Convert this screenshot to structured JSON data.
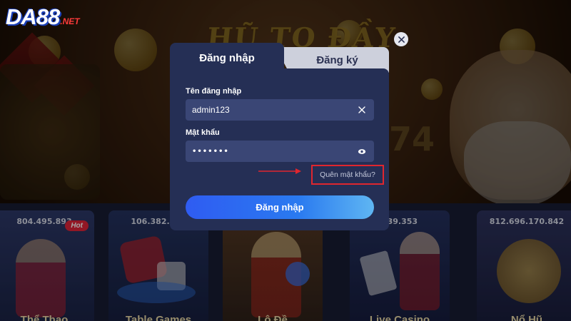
{
  "logo": {
    "main": "DA88",
    "sub": ".NET"
  },
  "background": {
    "jackpot_title": "HŨ TO ĐẦY",
    "side_number": "74"
  },
  "tabs": [
    {
      "label": "Đăng nhập",
      "active": true
    },
    {
      "label": "Đăng ký",
      "active": false
    }
  ],
  "form": {
    "username_label": "Tên đăng nhập",
    "username_value": "admin123",
    "password_label": "Mật khẩu",
    "password_value": "•••••••",
    "forgot_label": "Quên mật khẩu?",
    "submit_label": "Đăng nhập"
  },
  "games": [
    {
      "name": "Thể Thao",
      "amount": "804.495.893",
      "badge": "Hot"
    },
    {
      "name": "Table Games",
      "amount": "106.382.829"
    },
    {
      "name": "Lô Đề",
      "amount": ""
    },
    {
      "name": "Live Casino",
      "amount": "539.353"
    },
    {
      "name": "Nổ Hũ",
      "amount": "812.696.170.842"
    }
  ],
  "colors": {
    "accent": "#2f5cf2",
    "modal_bg": "#252f55",
    "field_bg": "#3a4675",
    "highlight": "#e0262e"
  },
  "icons": {
    "close": "close-icon",
    "clear": "clear-icon",
    "eye": "eye-icon",
    "arrow": "red-arrow-icon"
  }
}
